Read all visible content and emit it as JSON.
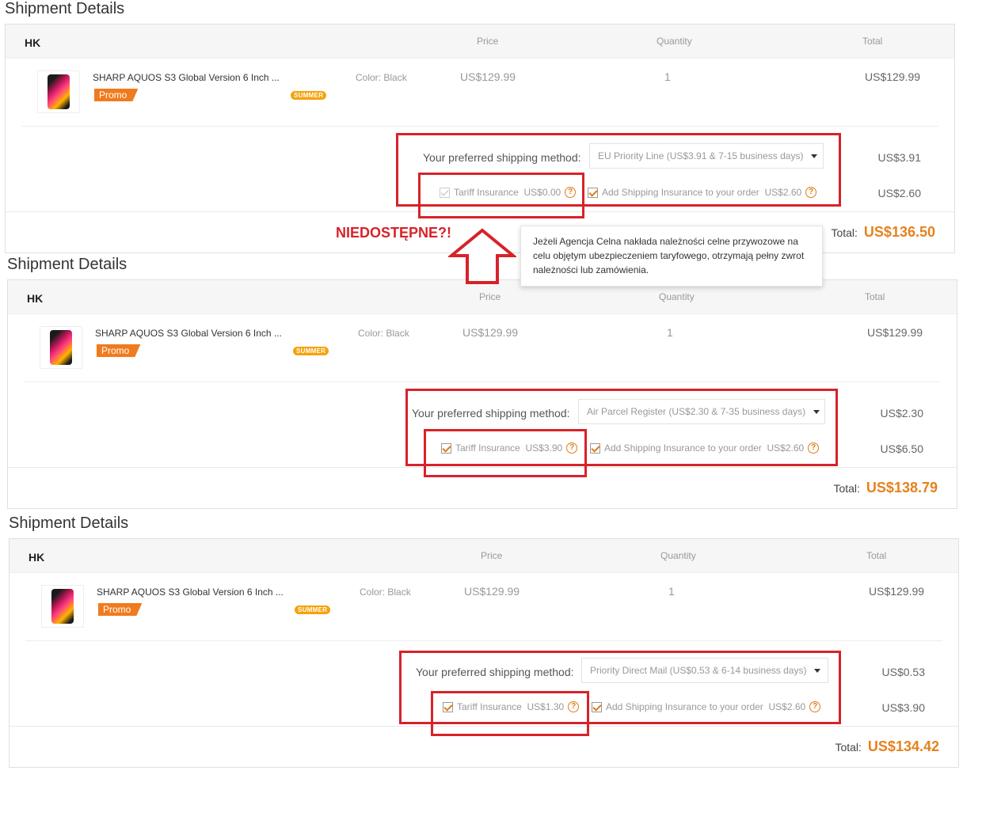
{
  "common": {
    "seller": "HK",
    "col_price": "Price",
    "col_quantity": "Quantity",
    "col_total": "Total",
    "product_name": "SHARP AQUOS S3 Global Version 6 Inch ...",
    "promo_label": "Promo",
    "summer_badge": "SUMMER",
    "color_label": "Color: Black",
    "ship_label": "Your preferred shipping method:",
    "tariff_label": "Tariff Insurance",
    "add_ship_label": "Add Shipping Insurance to your order",
    "total_label": "Total:"
  },
  "sections": [
    {
      "title": "Shipment Details",
      "price": "US$129.99",
      "quantity": "1",
      "item_total": "US$129.99",
      "ship_method": "EU Priority Line (US$3.91 & 7-15 business days)",
      "ship_cost": "US$3.91",
      "tariff_cost": "US$0.00",
      "tariff_checked": "disabled",
      "ship_ins_cost": "US$2.60",
      "ins_total": "US$2.60",
      "grand_total": "US$136.50"
    },
    {
      "title": "Shipment Details",
      "price": "US$129.99",
      "quantity": "1",
      "item_total": "US$129.99",
      "ship_method": "Air Parcel Register (US$2.30 & 7-35 business days)",
      "ship_cost": "US$2.30",
      "tariff_cost": "US$3.90",
      "tariff_checked": "checked",
      "ship_ins_cost": "US$2.60",
      "ins_total": "US$6.50",
      "grand_total": "US$138.79"
    },
    {
      "title": "Shipment Details",
      "price": "US$129.99",
      "quantity": "1",
      "item_total": "US$129.99",
      "ship_method": "Priority Direct Mail (US$0.53 & 6-14 business days)",
      "ship_cost": "US$0.53",
      "tariff_cost": "US$1.30",
      "tariff_checked": "checked",
      "ship_ins_cost": "US$2.60",
      "ins_total": "US$3.90",
      "grand_total": "US$134.42"
    }
  ],
  "tooltip": {
    "text": "Jeżeli Agencja Celna nakłada należności celne przywozowe na celu objętym ubezpieczeniem taryfowego, otrzymają pełny zwrot należności lub zamówienia."
  },
  "annotation": {
    "text": "NIEDOSTĘPNE?!",
    "color": "#d7222a"
  },
  "colors": {
    "accent": "#e6811c",
    "promo": "#f07b1e",
    "highlight": "#d7222a"
  }
}
